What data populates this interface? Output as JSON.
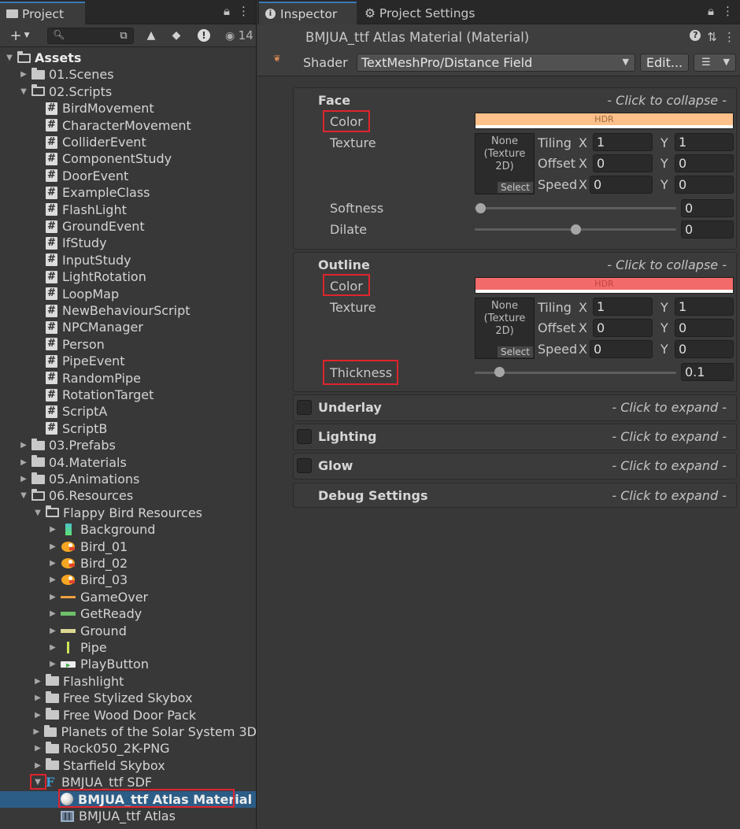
{
  "project": {
    "tab_label": "Project",
    "visible_count": "14",
    "tree": [
      {
        "label": "Assets",
        "depth": 0,
        "icon": "folder-open",
        "arrow": "down",
        "bold": true
      },
      {
        "label": "01.Scenes",
        "depth": 1,
        "icon": "folder",
        "arrow": "right"
      },
      {
        "label": "02.Scripts",
        "depth": 1,
        "icon": "folder-open",
        "arrow": "down"
      },
      {
        "label": "BirdMovement",
        "depth": 2,
        "icon": "script"
      },
      {
        "label": "CharacterMovement",
        "depth": 2,
        "icon": "script"
      },
      {
        "label": "ColliderEvent",
        "depth": 2,
        "icon": "script"
      },
      {
        "label": "ComponentStudy",
        "depth": 2,
        "icon": "script"
      },
      {
        "label": "DoorEvent",
        "depth": 2,
        "icon": "script"
      },
      {
        "label": "ExampleClass",
        "depth": 2,
        "icon": "script"
      },
      {
        "label": "FlashLight",
        "depth": 2,
        "icon": "script"
      },
      {
        "label": "GroundEvent",
        "depth": 2,
        "icon": "script"
      },
      {
        "label": "IfStudy",
        "depth": 2,
        "icon": "script"
      },
      {
        "label": "InputStudy",
        "depth": 2,
        "icon": "script"
      },
      {
        "label": "LightRotation",
        "depth": 2,
        "icon": "script"
      },
      {
        "label": "LoopMap",
        "depth": 2,
        "icon": "script"
      },
      {
        "label": "NewBehaviourScript",
        "depth": 2,
        "icon": "script"
      },
      {
        "label": "NPCManager",
        "depth": 2,
        "icon": "script"
      },
      {
        "label": "Person",
        "depth": 2,
        "icon": "script"
      },
      {
        "label": "PipeEvent",
        "depth": 2,
        "icon": "script"
      },
      {
        "label": "RandomPipe",
        "depth": 2,
        "icon": "script"
      },
      {
        "label": "RotationTarget",
        "depth": 2,
        "icon": "script"
      },
      {
        "label": "ScriptA",
        "depth": 2,
        "icon": "script"
      },
      {
        "label": "ScriptB",
        "depth": 2,
        "icon": "script"
      },
      {
        "label": "03.Prefabs",
        "depth": 1,
        "icon": "folder",
        "arrow": "right"
      },
      {
        "label": "04.Materials",
        "depth": 1,
        "icon": "folder",
        "arrow": "right"
      },
      {
        "label": "05.Animations",
        "depth": 1,
        "icon": "folder",
        "arrow": "right"
      },
      {
        "label": "06.Resources",
        "depth": 1,
        "icon": "folder-open",
        "arrow": "down"
      },
      {
        "label": "Flappy Bird Resources",
        "depth": 2,
        "icon": "folder-open",
        "arrow": "down"
      },
      {
        "label": "Background",
        "depth": 3,
        "icon": "sprite-background",
        "arrow": "right"
      },
      {
        "label": "Bird_01",
        "depth": 3,
        "icon": "sprite-bird",
        "arrow": "right"
      },
      {
        "label": "Bird_02",
        "depth": 3,
        "icon": "sprite-bird",
        "arrow": "right"
      },
      {
        "label": "Bird_03",
        "depth": 3,
        "icon": "sprite-bird",
        "arrow": "right"
      },
      {
        "label": "GameOver",
        "depth": 3,
        "icon": "sprite-gameover",
        "arrow": "right"
      },
      {
        "label": "GetReady",
        "depth": 3,
        "icon": "sprite-getready",
        "arrow": "right"
      },
      {
        "label": "Ground",
        "depth": 3,
        "icon": "sprite-ground",
        "arrow": "right"
      },
      {
        "label": "Pipe",
        "depth": 3,
        "icon": "sprite-pipe",
        "arrow": "right"
      },
      {
        "label": "PlayButton",
        "depth": 3,
        "icon": "sprite-playbutton",
        "arrow": "right"
      },
      {
        "label": "Flashlight",
        "depth": 2,
        "icon": "folder",
        "arrow": "right"
      },
      {
        "label": "Free Stylized Skybox",
        "depth": 2,
        "icon": "folder",
        "arrow": "right"
      },
      {
        "label": "Free Wood Door Pack",
        "depth": 2,
        "icon": "folder",
        "arrow": "right"
      },
      {
        "label": "Planets of the Solar System 3D",
        "depth": 2,
        "icon": "folder",
        "arrow": "right"
      },
      {
        "label": "Rock050_2K-PNG",
        "depth": 2,
        "icon": "folder",
        "arrow": "right"
      },
      {
        "label": "Starfield Skybox",
        "depth": 2,
        "icon": "folder",
        "arrow": "right"
      },
      {
        "label": "BMJUA_ttf SDF",
        "depth": 2,
        "icon": "font-asset",
        "arrow": "down"
      },
      {
        "label": "BMJUA_ttf Atlas Material",
        "depth": 3,
        "icon": "material",
        "selected": true,
        "bold": true
      },
      {
        "label": "BMJUA_ttf Atlas",
        "depth": 3,
        "icon": "texture-atlas"
      }
    ]
  },
  "inspector": {
    "tab_label": "Inspector",
    "tab2_label": "Project Settings",
    "material_title": "BMJUA_ttf Atlas Material (Material)",
    "shader_label": "Shader",
    "shader_value": "TextMeshPro/Distance Field",
    "edit_label": "Edit...",
    "face": {
      "title": "Face",
      "hint": "- Click to collapse -",
      "color_label": "Color",
      "color_value": "#ffc08a",
      "hdr": "HDR",
      "texture_label": "Texture",
      "tex_none": "None (Texture 2D)",
      "tex_select": "Select",
      "tiling_label": "Tiling",
      "offset_label": "Offset",
      "speed_label": "Speed",
      "x_label": "X",
      "y_label": "Y",
      "tiling_x": "1",
      "tiling_y": "1",
      "offset_x": "0",
      "offset_y": "0",
      "speed_x": "0",
      "speed_y": "0",
      "softness_label": "Softness",
      "softness_value": "0",
      "dilate_label": "Dilate",
      "dilate_value": "0"
    },
    "outline": {
      "title": "Outline",
      "hint": "- Click to collapse -",
      "color_label": "Color",
      "color_value": "#f36a6a",
      "hdr": "HDR",
      "texture_label": "Texture",
      "tex_none": "None (Texture 2D)",
      "tex_select": "Select",
      "tiling_label": "Tiling",
      "offset_label": "Offset",
      "speed_label": "Speed",
      "x_label": "X",
      "y_label": "Y",
      "tiling_x": "1",
      "tiling_y": "1",
      "offset_x": "0",
      "offset_y": "0",
      "speed_x": "0",
      "speed_y": "0",
      "thickness_label": "Thickness",
      "thickness_value": "0.1"
    },
    "collapsed_sections": [
      {
        "title": "Underlay",
        "hint": "- Click to expand -",
        "checkbox": true
      },
      {
        "title": "Lighting",
        "hint": "- Click to expand -",
        "checkbox": true
      },
      {
        "title": "Glow",
        "hint": "- Click to expand -",
        "checkbox": true
      },
      {
        "title": "Debug Settings",
        "hint": "- Click to expand -",
        "checkbox": false
      }
    ]
  },
  "colors": {
    "selection": "#2c5d87",
    "highlight_box": "#e0242d",
    "script_icon": "#dcdcdc"
  }
}
